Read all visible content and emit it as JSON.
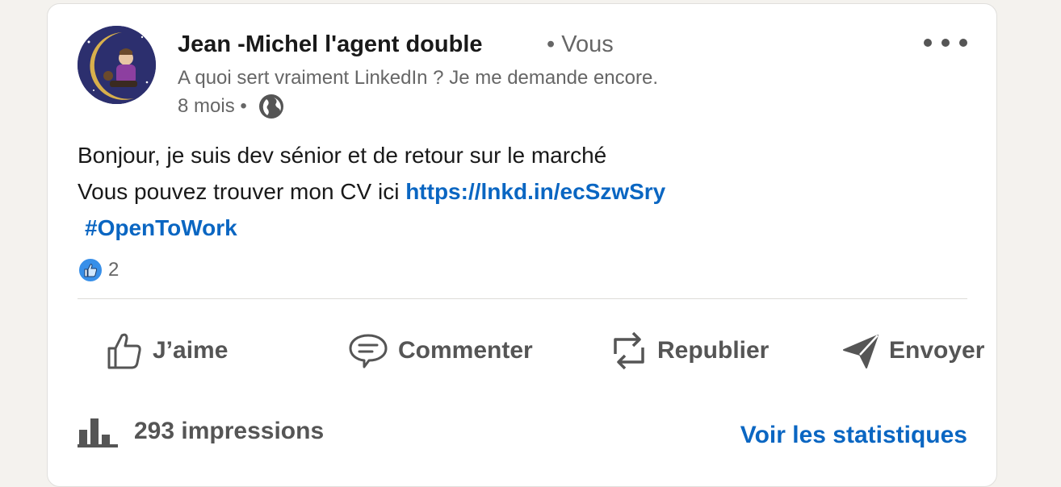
{
  "post": {
    "author": {
      "name": "Jean -Michel l'agent double",
      "relation": "• Vous",
      "headline": "A quoi sert vraiment LinkedIn ? Je me demande encore.",
      "time": "8 mois •"
    },
    "body": {
      "line1": "Bonjour, je suis dev sénior et de retour sur le marché",
      "line2_prefix": "Vous pouvez trouver mon CV ici ",
      "link": "https://lnkd.in/ecSzwSry",
      "hashtag": "#OpenToWork"
    },
    "reactions": {
      "icon": "like-reaction-icon",
      "count": "2"
    },
    "actions": [
      {
        "label": "J’aime",
        "icon": "thumbs-up-icon"
      },
      {
        "label": "Commenter",
        "icon": "comment-icon"
      },
      {
        "label": "Republier",
        "icon": "repost-icon"
      },
      {
        "label": "Envoyer",
        "icon": "send-icon"
      }
    ],
    "stats": {
      "impressions": "293 impressions",
      "view_stats": "Voir les statistiques"
    }
  },
  "colors": {
    "link": "#0a66c2",
    "muted": "#666666",
    "background": "#f4f2ee"
  }
}
